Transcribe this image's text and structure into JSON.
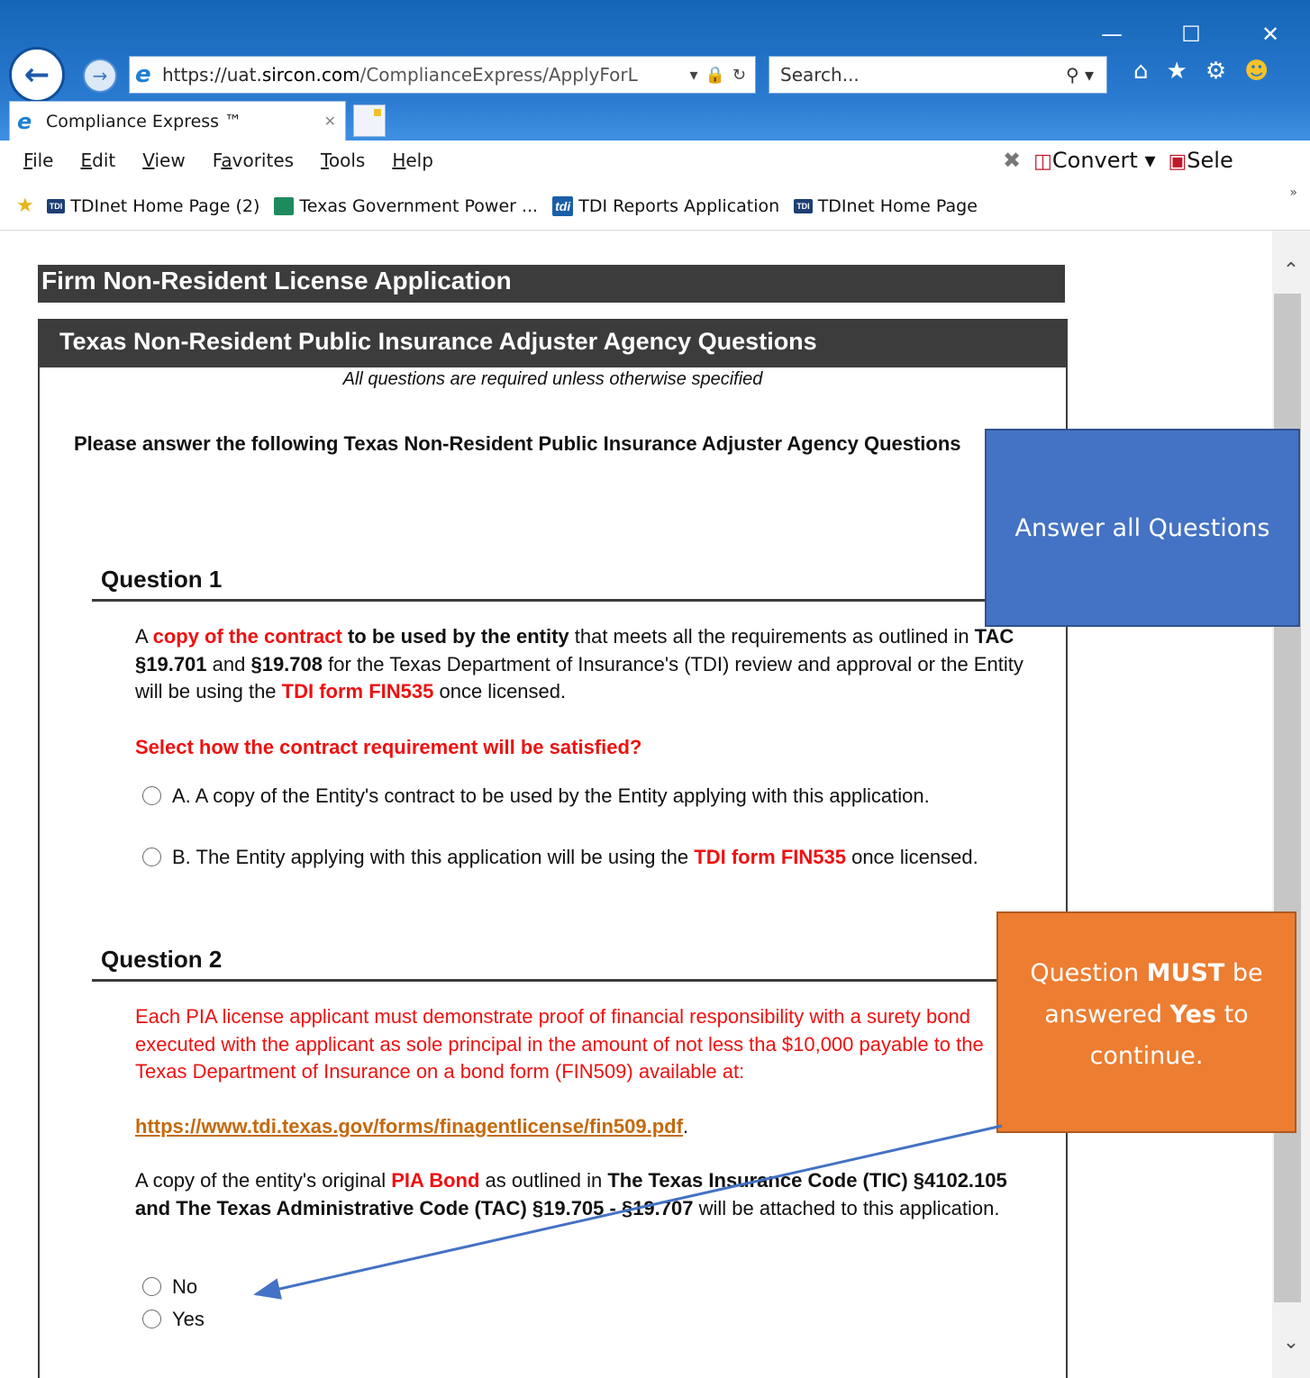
{
  "window": {
    "minimize": "—",
    "maximize": "☐",
    "close": "✕"
  },
  "browser": {
    "url_prefix": "https://uat.",
    "url_host": "sircon.com",
    "url_path": "/ComplianceExpress/ApplyForL",
    "search_placeholder": "Search...",
    "tab_title": "Compliance Express ™"
  },
  "menu": {
    "file": "ile",
    "file_key": "F",
    "edit": "dit",
    "edit_key": "E",
    "view": "iew",
    "view_key": "V",
    "favorites_pre": "F",
    "favorites_key": "a",
    "favorites_post": "vorites",
    "tools": "ools",
    "tools_key": "T",
    "help": "elp",
    "help_key": "H",
    "convert": "Convert",
    "select": "Sele"
  },
  "favorites": [
    {
      "label": "TDInet Home Page (2)",
      "badge": "TDI"
    },
    {
      "label": "Texas Government Power ...",
      "badge": ""
    },
    {
      "label": "TDI Reports Application",
      "badge": "tdi"
    },
    {
      "label": "TDInet Home Page",
      "badge": "TDI"
    }
  ],
  "page": {
    "header": "Firm Non-Resident License Application",
    "panel_title": "Texas Non-Resident Public Insurance Adjuster Agency Questions",
    "required_note": "All questions are required unless otherwise specified",
    "intro": "Please answer the following Texas Non-Resident Public Insurance Adjuster Agency Questions"
  },
  "q1": {
    "heading": "Question 1",
    "p_a": "A ",
    "p_copy": "copy of the contract",
    "p_b": " to be used by the entity",
    "p_c": " that meets all the requirements as outlined in ",
    "p_tac1": "TAC §19.701",
    "p_and": " and ",
    "p_tac2": "§19.708",
    "p_d": " for the Texas Department of Insurance's (TDI) review and approval or the Entity will be using the ",
    "p_form": "TDI form FIN535",
    "p_e": " once licensed.",
    "prompt": "Select how the contract requirement will be satisfied?",
    "opt_a": "A. A copy of the Entity's contract to be used by the Entity applying with this application.",
    "opt_b_a": "B. The Entity applying with this application will be using the ",
    "opt_b_form": "TDI form FIN535",
    "opt_b_b": " once licensed."
  },
  "q2": {
    "heading": "Question 2",
    "bond_text": "Each PIA license applicant must demonstrate proof of financial responsibility with a surety bond executed with the applicant as sole principal in the amount of not less tha $10,000 payable to the Texas Department of Insurance on a bond form (FIN509) available at:",
    "link": "https://www.tdi.texas.gov/forms/finagentlicense/fin509.pdf",
    "link_after": ".",
    "p_a": "A copy of the entity's original ",
    "p_bond": "PIA Bond",
    "p_b": " as outlined in ",
    "p_code": "The Texas Insurance Code (TIC) §4102.105 and The Texas Administrative Code (TAC) §19.705 - §19.707",
    "p_c": " will be attached to this application.",
    "no": "No",
    "yes": "Yes"
  },
  "callouts": {
    "blue": "Answer all Questions",
    "orange_a": "Question ",
    "orange_must": "MUST",
    "orange_b": " be answered ",
    "orange_yes": "Yes",
    "orange_c": " to continue."
  },
  "colors": {
    "header_bg": "#3c3c3c",
    "red_text": "#ee1111",
    "callout_blue": "#4472c4",
    "callout_orange": "#ed7d31",
    "arrow": "#4472c4"
  }
}
